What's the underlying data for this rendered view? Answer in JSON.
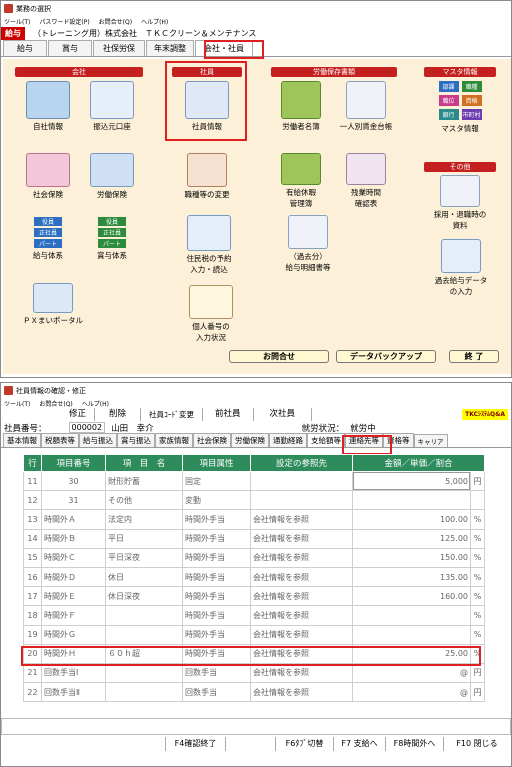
{
  "w1": {
    "title": "業務の選択",
    "menu": [
      "ツール(T)",
      "パスワード設定(P)",
      "お問合せ(Q)",
      "ヘルプ(H)"
    ],
    "app": "給与",
    "company": "（トレーニング用）株式会社　ＴＫＣクリーン＆メンテナンス",
    "tabs": [
      "給与",
      "賞与",
      "社保労保",
      "年末調整",
      "会社・社員"
    ],
    "sections": {
      "kaisha": "会社",
      "shain": "社員",
      "hozon": "労働保存書類",
      "master": "マスタ情報",
      "other": "その他"
    },
    "icons": {
      "jisha": "自社情報",
      "furikomi": "振込元口座",
      "shain": "社員情報",
      "rodosha": "労働者名簿",
      "chingin": "一人別賃金台帳",
      "master": "マスタ情報",
      "shakai": "社会保険",
      "rodo": "労働保険",
      "shokushu": "職種等の変更",
      "yukyu1": "有給休暇",
      "yukyu2": "管理簿",
      "zangyo1": "残業時間",
      "zangyo2": "確認表",
      "kyuyo": "給与体系",
      "shoyo": "賞与体系",
      "jumin1": "住民税の予約",
      "jumin2": "入力・読込",
      "kako1": "（過去分）",
      "kako2": "給与明細書等",
      "saiyo1": "採用・退職時の",
      "saiyo2": "資料",
      "kakodata1": "過去給与データ",
      "kakodata2": "の入力",
      "px": "ＰＸまいポータル",
      "mynum1": "個人番号の",
      "mynum2": "入力状況"
    },
    "master_labels": [
      "部課",
      "職種",
      "職位",
      "資格",
      "銀行",
      "市町村"
    ],
    "pay_labels": [
      "役員",
      "正社員",
      "パート"
    ],
    "buttons": {
      "contact": "お問合せ",
      "backup": "データバックアップ",
      "exit": "終 了"
    }
  },
  "w2": {
    "title": "社員情報の確認・修正",
    "menu": [
      "ツール(T)",
      "お問合せ(Q)",
      "ヘルプ(H)"
    ],
    "toolbar": [
      "修正",
      "削除",
      "社員ｺｰﾄﾞ変更",
      "前社員",
      "次社員"
    ],
    "badge": "TKCｼｽﾃﾑQ&A",
    "emp_label": "社員番号：",
    "emp_no": "000002",
    "emp_name": "山田　幸介",
    "status_label": "就労状況：",
    "status": "就労中",
    "tabs": [
      "基本情報",
      "税額表等",
      "給与振込",
      "賞与振込",
      "家族情報",
      "社会保険",
      "労働保険",
      "通勤経路",
      "支給額等",
      "連絡先等",
      "資格等",
      "キャリア"
    ],
    "headers": [
      "行",
      "項目番号",
      "項　目　名",
      "項目属性",
      "設定の参照先",
      "金額／単価／割合"
    ],
    "rows": [
      [
        "11",
        "30",
        "財形貯蓄",
        "固定",
        "",
        "5,000",
        "円"
      ],
      [
        "12",
        "31",
        "その他",
        "変動",
        "",
        "",
        ""
      ],
      [
        "13",
        "時間外Ａ",
        "法定内",
        "時間外手当",
        "会社情報を参照",
        "100.00",
        "%"
      ],
      [
        "14",
        "時間外Ｂ",
        "平日",
        "時間外手当",
        "会社情報を参照",
        "125.00",
        "%"
      ],
      [
        "15",
        "時間外Ｃ",
        "平日深夜",
        "時間外手当",
        "会社情報を参照",
        "150.00",
        "%"
      ],
      [
        "16",
        "時間外Ｄ",
        "休日",
        "時間外手当",
        "会社情報を参照",
        "135.00",
        "%"
      ],
      [
        "17",
        "時間外Ｅ",
        "休日深夜",
        "時間外手当",
        "会社情報を参照",
        "160.00",
        "%"
      ],
      [
        "18",
        "時間外Ｆ",
        "",
        "時間外手当",
        "会社情報を参照",
        "",
        "%"
      ],
      [
        "19",
        "時間外Ｇ",
        "",
        "時間外手当",
        "会社情報を参照",
        "",
        "%"
      ],
      [
        "20",
        "時間外Ｈ",
        "６０ｈ超",
        "時間外手当",
        "会社情報を参照",
        "25.00",
        "%"
      ],
      [
        "21",
        "回数手当Ⅰ",
        "",
        "回数手当",
        "会社情報を参照",
        "@",
        "円"
      ],
      [
        "22",
        "回数手当Ⅱ",
        "",
        "回数手当",
        "会社情報を参照",
        "@",
        "円"
      ]
    ],
    "fkeys": [
      "",
      "F4確認終了",
      "",
      "F6ﾀﾌﾞ切替",
      "F7 支給へ",
      "F8時間外へ",
      "F10 閉じる"
    ]
  }
}
